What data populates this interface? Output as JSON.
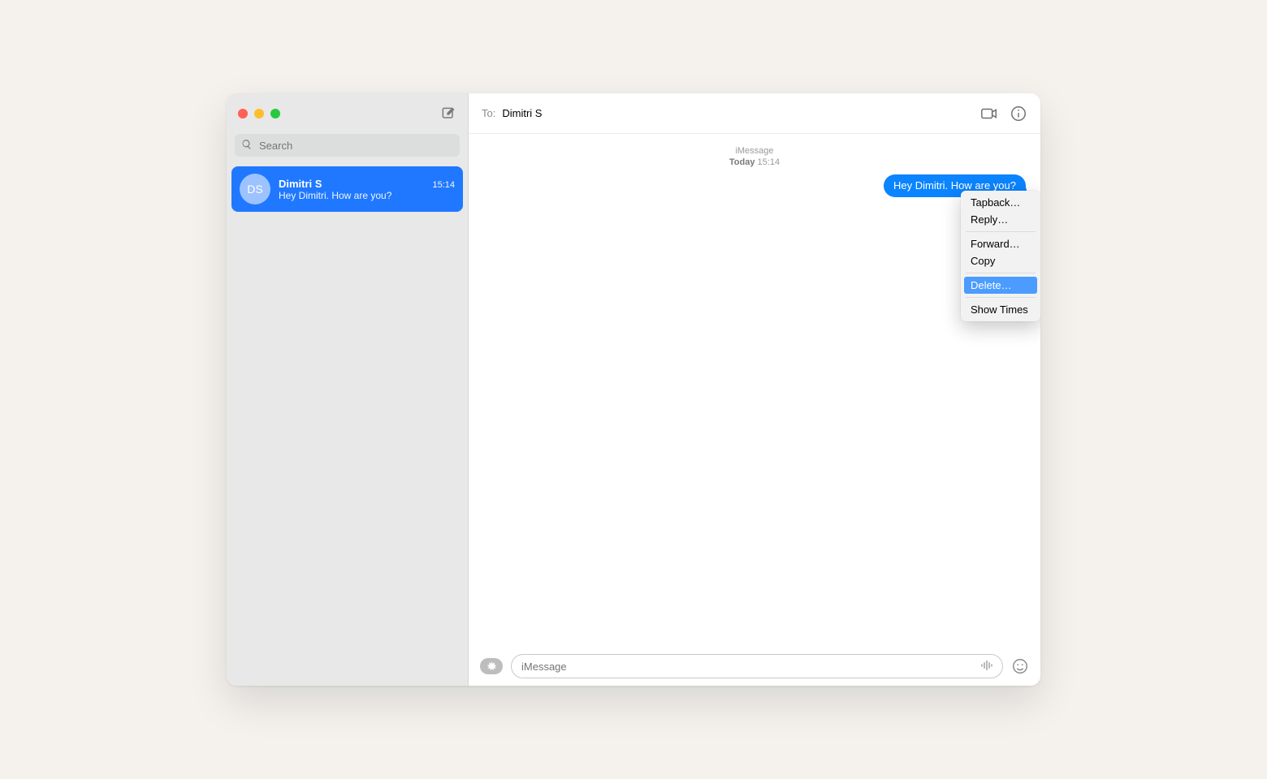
{
  "sidebar": {
    "search_placeholder": "Search",
    "conversations": [
      {
        "initials": "DS",
        "name": "Dimitri S",
        "time": "15:14",
        "preview": "Hey Dimitri. How are you?"
      }
    ]
  },
  "header": {
    "to_label": "To:",
    "to_value": "Dimitri S"
  },
  "thread": {
    "service": "iMessage",
    "day": "Today",
    "time": "15:14",
    "messages": [
      {
        "direction": "out",
        "text": "Hey Dimitri. How are you?"
      }
    ]
  },
  "context_menu": {
    "items": [
      {
        "label": "Tapback…",
        "highlighted": false
      },
      {
        "label": "Reply…",
        "highlighted": false
      },
      {
        "sep": true
      },
      {
        "label": "Forward…",
        "highlighted": false
      },
      {
        "label": "Copy",
        "highlighted": false
      },
      {
        "sep": true
      },
      {
        "label": "Delete…",
        "highlighted": true
      },
      {
        "sep": true
      },
      {
        "label": "Show Times",
        "highlighted": false
      }
    ]
  },
  "compose": {
    "placeholder": "iMessage"
  }
}
